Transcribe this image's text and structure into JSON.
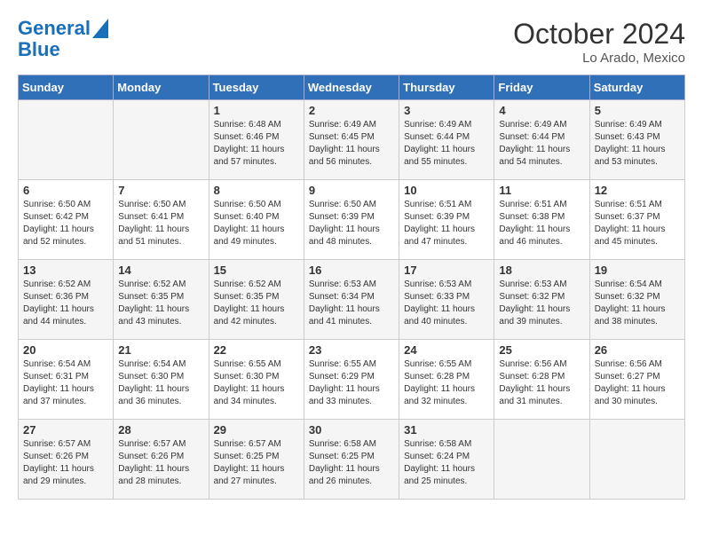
{
  "logo": {
    "line1": "General",
    "line2": "Blue"
  },
  "title": "October 2024",
  "location": "Lo Arado, Mexico",
  "days_of_week": [
    "Sunday",
    "Monday",
    "Tuesday",
    "Wednesday",
    "Thursday",
    "Friday",
    "Saturday"
  ],
  "weeks": [
    [
      {
        "day": "",
        "info": ""
      },
      {
        "day": "",
        "info": ""
      },
      {
        "day": "1",
        "info": "Sunrise: 6:48 AM\nSunset: 6:46 PM\nDaylight: 11 hours and 57 minutes."
      },
      {
        "day": "2",
        "info": "Sunrise: 6:49 AM\nSunset: 6:45 PM\nDaylight: 11 hours and 56 minutes."
      },
      {
        "day": "3",
        "info": "Sunrise: 6:49 AM\nSunset: 6:44 PM\nDaylight: 11 hours and 55 minutes."
      },
      {
        "day": "4",
        "info": "Sunrise: 6:49 AM\nSunset: 6:44 PM\nDaylight: 11 hours and 54 minutes."
      },
      {
        "day": "5",
        "info": "Sunrise: 6:49 AM\nSunset: 6:43 PM\nDaylight: 11 hours and 53 minutes."
      }
    ],
    [
      {
        "day": "6",
        "info": "Sunrise: 6:50 AM\nSunset: 6:42 PM\nDaylight: 11 hours and 52 minutes."
      },
      {
        "day": "7",
        "info": "Sunrise: 6:50 AM\nSunset: 6:41 PM\nDaylight: 11 hours and 51 minutes."
      },
      {
        "day": "8",
        "info": "Sunrise: 6:50 AM\nSunset: 6:40 PM\nDaylight: 11 hours and 49 minutes."
      },
      {
        "day": "9",
        "info": "Sunrise: 6:50 AM\nSunset: 6:39 PM\nDaylight: 11 hours and 48 minutes."
      },
      {
        "day": "10",
        "info": "Sunrise: 6:51 AM\nSunset: 6:39 PM\nDaylight: 11 hours and 47 minutes."
      },
      {
        "day": "11",
        "info": "Sunrise: 6:51 AM\nSunset: 6:38 PM\nDaylight: 11 hours and 46 minutes."
      },
      {
        "day": "12",
        "info": "Sunrise: 6:51 AM\nSunset: 6:37 PM\nDaylight: 11 hours and 45 minutes."
      }
    ],
    [
      {
        "day": "13",
        "info": "Sunrise: 6:52 AM\nSunset: 6:36 PM\nDaylight: 11 hours and 44 minutes."
      },
      {
        "day": "14",
        "info": "Sunrise: 6:52 AM\nSunset: 6:35 PM\nDaylight: 11 hours and 43 minutes."
      },
      {
        "day": "15",
        "info": "Sunrise: 6:52 AM\nSunset: 6:35 PM\nDaylight: 11 hours and 42 minutes."
      },
      {
        "day": "16",
        "info": "Sunrise: 6:53 AM\nSunset: 6:34 PM\nDaylight: 11 hours and 41 minutes."
      },
      {
        "day": "17",
        "info": "Sunrise: 6:53 AM\nSunset: 6:33 PM\nDaylight: 11 hours and 40 minutes."
      },
      {
        "day": "18",
        "info": "Sunrise: 6:53 AM\nSunset: 6:32 PM\nDaylight: 11 hours and 39 minutes."
      },
      {
        "day": "19",
        "info": "Sunrise: 6:54 AM\nSunset: 6:32 PM\nDaylight: 11 hours and 38 minutes."
      }
    ],
    [
      {
        "day": "20",
        "info": "Sunrise: 6:54 AM\nSunset: 6:31 PM\nDaylight: 11 hours and 37 minutes."
      },
      {
        "day": "21",
        "info": "Sunrise: 6:54 AM\nSunset: 6:30 PM\nDaylight: 11 hours and 36 minutes."
      },
      {
        "day": "22",
        "info": "Sunrise: 6:55 AM\nSunset: 6:30 PM\nDaylight: 11 hours and 34 minutes."
      },
      {
        "day": "23",
        "info": "Sunrise: 6:55 AM\nSunset: 6:29 PM\nDaylight: 11 hours and 33 minutes."
      },
      {
        "day": "24",
        "info": "Sunrise: 6:55 AM\nSunset: 6:28 PM\nDaylight: 11 hours and 32 minutes."
      },
      {
        "day": "25",
        "info": "Sunrise: 6:56 AM\nSunset: 6:28 PM\nDaylight: 11 hours and 31 minutes."
      },
      {
        "day": "26",
        "info": "Sunrise: 6:56 AM\nSunset: 6:27 PM\nDaylight: 11 hours and 30 minutes."
      }
    ],
    [
      {
        "day": "27",
        "info": "Sunrise: 6:57 AM\nSunset: 6:26 PM\nDaylight: 11 hours and 29 minutes."
      },
      {
        "day": "28",
        "info": "Sunrise: 6:57 AM\nSunset: 6:26 PM\nDaylight: 11 hours and 28 minutes."
      },
      {
        "day": "29",
        "info": "Sunrise: 6:57 AM\nSunset: 6:25 PM\nDaylight: 11 hours and 27 minutes."
      },
      {
        "day": "30",
        "info": "Sunrise: 6:58 AM\nSunset: 6:25 PM\nDaylight: 11 hours and 26 minutes."
      },
      {
        "day": "31",
        "info": "Sunrise: 6:58 AM\nSunset: 6:24 PM\nDaylight: 11 hours and 25 minutes."
      },
      {
        "day": "",
        "info": ""
      },
      {
        "day": "",
        "info": ""
      }
    ]
  ]
}
